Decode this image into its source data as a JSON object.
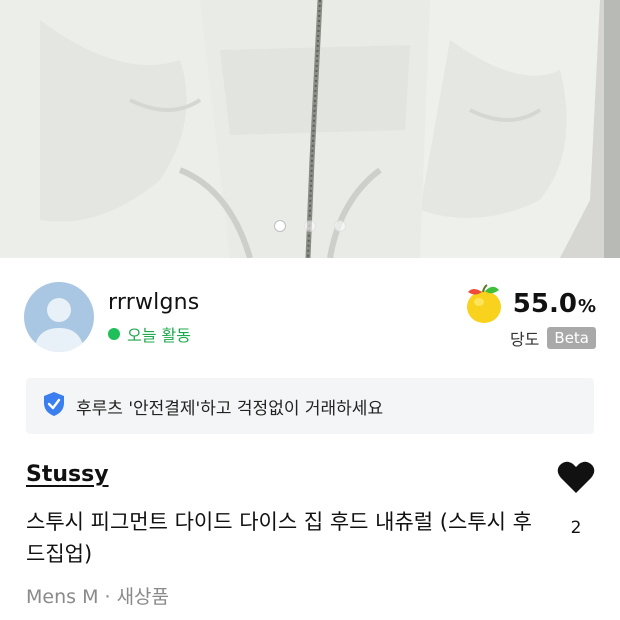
{
  "hero": {
    "image_description": "",
    "slide_count": 3,
    "active_slide": 1
  },
  "seller": {
    "name": "rrrwlgns",
    "activity": "오늘 활동",
    "score_value": "55.0",
    "score_unit": "%",
    "score_label": "당도",
    "beta_label": "Beta",
    "activity_color": "#1fbf5a"
  },
  "safe_payment": {
    "text": "후루츠 '안전결제'하고 걱정없이 거래하세요",
    "icon": "shield-check-icon",
    "icon_color": "#3a7ef0"
  },
  "product": {
    "brand": "Stussy",
    "title": "스투시 피그먼트 다이드 다이스 집 후드 내츄럴 (스투시 후드집업)",
    "meta": "Mens M · 새상품",
    "like_count": "2"
  }
}
